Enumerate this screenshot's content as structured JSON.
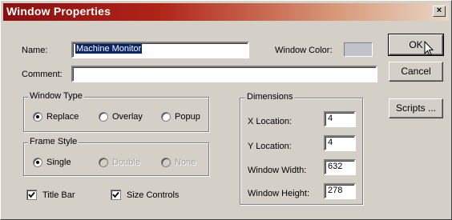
{
  "window": {
    "title": "Window Properties",
    "close_glyph": "×"
  },
  "name_field": {
    "label": "Name:",
    "value": "Machine Monitor"
  },
  "window_color": {
    "label": "Window Color:",
    "color": "#c0c4c8"
  },
  "comment_field": {
    "label": "Comment:",
    "value": ""
  },
  "buttons": {
    "ok": "OK",
    "cancel": "Cancel",
    "scripts": "Scripts ..."
  },
  "window_type": {
    "legend": "Window Type",
    "options": [
      "Replace",
      "Overlay",
      "Popup"
    ],
    "selected": "Replace"
  },
  "frame_style": {
    "legend": "Frame Style",
    "options": [
      "Single",
      "Double",
      "None"
    ],
    "selected": "Single",
    "disabled": [
      "Double",
      "None"
    ]
  },
  "checkboxes": {
    "title_bar": "Title Bar",
    "size_controls": "Size Controls"
  },
  "dimensions": {
    "legend": "Dimensions",
    "x_label": "X Location:",
    "x_value": "4",
    "y_label": "Y Location:",
    "y_value": "4",
    "w_label": "Window Width:",
    "w_value": "632",
    "h_label": "Window Height:",
    "h_value": "278"
  }
}
